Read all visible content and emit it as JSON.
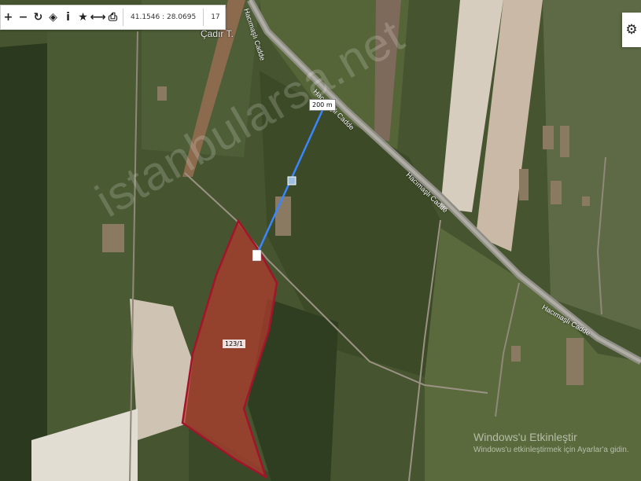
{
  "toolbar": {
    "buttons": [
      {
        "icon": "plus-icon",
        "glyph": "+"
      },
      {
        "icon": "minus-icon",
        "glyph": "−"
      },
      {
        "icon": "refresh-icon",
        "glyph": "↻"
      },
      {
        "icon": "locate-icon",
        "glyph": "◈"
      },
      {
        "icon": "info-icon",
        "glyph": "i"
      },
      {
        "icon": "star-icon",
        "glyph": "★"
      },
      {
        "icon": "measure-icon",
        "glyph": "⟷"
      },
      {
        "icon": "print-icon",
        "glyph": "⎙"
      }
    ],
    "coordinates": "41.1546 : 28.0695",
    "zoom": "17"
  },
  "map": {
    "place_label": "Çadır T.",
    "road_labels": [
      "Hacımaşlı Cadde",
      "Hacımaşlı Cadde",
      "Hacımaşlı Cadde",
      "Hacımaşlı Cadde"
    ],
    "measure_label": "200 m",
    "parcel_label": "123/1",
    "watermark": "istanbularsa.net",
    "colors": {
      "measure_line": "#3a86ff",
      "parcel_fill": "#b33a2e",
      "parcel_stroke": "#a3142a"
    }
  },
  "settings": {
    "icon": "gear-icon",
    "glyph": "⚙"
  },
  "windows_activation": {
    "title": "Windows'u Etkinleştir",
    "subtitle": "Windows'u etkinleştirmek için Ayarlar'a gidin."
  }
}
